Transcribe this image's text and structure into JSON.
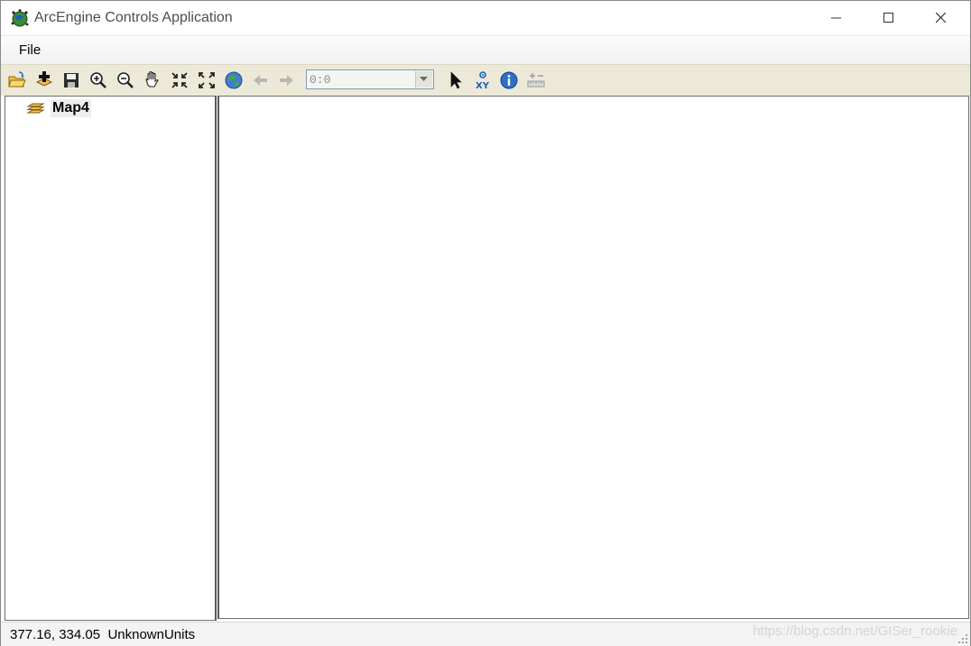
{
  "window": {
    "title": "ArcEngine Controls Application",
    "icon": "arcgis-globe-icon",
    "controls": [
      "minimize-icon",
      "maximize-icon",
      "close-icon"
    ]
  },
  "menu": {
    "items": [
      {
        "label": "File"
      }
    ]
  },
  "toolbar": {
    "tools": [
      {
        "name": "open-document-icon"
      },
      {
        "name": "add-data-icon"
      },
      {
        "name": "save-icon"
      },
      {
        "name": "zoom-in-icon"
      },
      {
        "name": "zoom-out-icon"
      },
      {
        "name": "pan-icon"
      },
      {
        "name": "fixed-zoom-in-icon"
      },
      {
        "name": "fixed-zoom-out-icon"
      },
      {
        "name": "full-extent-icon"
      },
      {
        "name": "back-extent-icon"
      },
      {
        "name": "forward-extent-icon"
      },
      {
        "name": "select-features-icon"
      },
      {
        "name": "go-to-xy-icon"
      },
      {
        "name": "identify-icon"
      },
      {
        "name": "measure-icon"
      }
    ],
    "scale_value": "0:0"
  },
  "toc": {
    "map_label": "Map4",
    "map_icon": "layers-icon"
  },
  "status": {
    "coordinates": "377.16, 334.05",
    "units": "UnknownUnits"
  },
  "watermark": "https://blog.csdn.net/GISer_rookie",
  "colors": {
    "toolbar_bg": "#ece9d8",
    "panel_bg": "#ffffff",
    "status_bg": "#f3f3f3"
  }
}
